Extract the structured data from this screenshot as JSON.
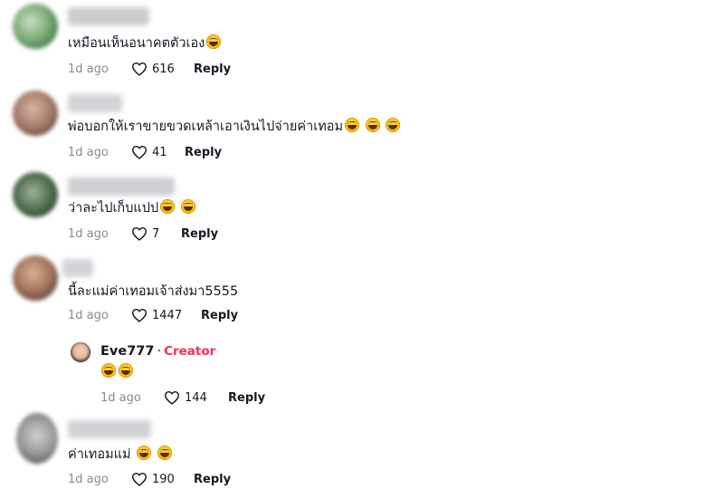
{
  "comments": [
    {
      "text": "เหมือนเห็นอนาคตตัวเอง",
      "emojis": 1,
      "date": "1d ago",
      "likes": "616",
      "reply": "Reply"
    },
    {
      "text": "พ่อบอกให้เราขายขวดเหล้าเอาเงินไปจ่ายค่าเทอม",
      "emojis": 3,
      "date": "1d ago",
      "likes": "41",
      "reply": "Reply"
    },
    {
      "text": "ว่าละไปเก็บแปป",
      "emojis": 2,
      "date": "1d ago",
      "likes": "7",
      "reply": "Reply"
    },
    {
      "text": "นี้ละแม่ค่าเทอมเจ้าส่งมา5555",
      "emojis": 0,
      "date": "1d ago",
      "likes": "1447",
      "reply": "Reply"
    },
    {
      "text": "ค่าเทอมแม่",
      "emojis": 2,
      "date": "1d ago",
      "likes": "190",
      "reply": "Reply"
    }
  ],
  "creator_reply": {
    "name": "Eve777",
    "separator": "·",
    "badge": "Creator",
    "emojis": 2,
    "date": "1d ago",
    "likes": "144",
    "reply": "Reply"
  },
  "colors": {
    "creator_badge": "#fe2c55",
    "meta_text": "#8a8b91",
    "text": "#161823"
  },
  "icons": {
    "like": "heart-outline-icon",
    "emoji": "grinning-sweat-emoji-icon"
  }
}
